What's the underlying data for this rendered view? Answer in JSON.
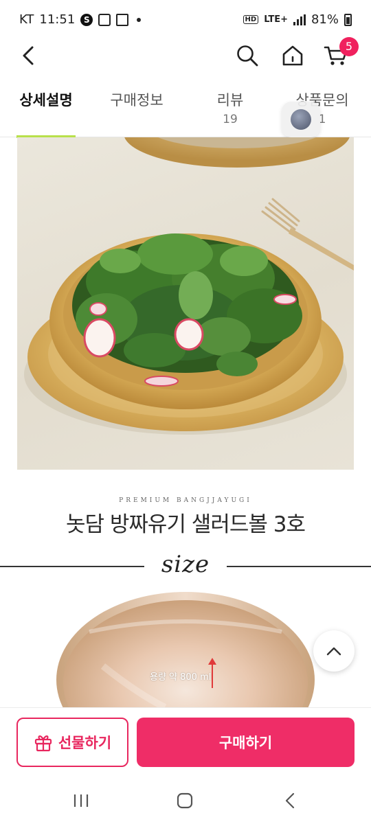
{
  "status_bar": {
    "carrier": "KT",
    "time": "11:51",
    "network": "LTE+",
    "hd": "HD",
    "battery": "81%"
  },
  "header": {
    "icons": [
      "back-icon",
      "search-icon",
      "home-icon",
      "cart-icon"
    ],
    "cart_count": "5"
  },
  "tabs": [
    {
      "label": "상세설명",
      "count": "",
      "active": true
    },
    {
      "label": "구매정보",
      "count": ""
    },
    {
      "label": "리뷰",
      "count": "19"
    },
    {
      "label": "상품문의",
      "count": "1"
    }
  ],
  "detail": {
    "brand_line": "PREMIUM BANGJJAYUGI",
    "title": "놋담 방짜유기 샐러드볼 3호",
    "size_label": "size",
    "capacity": "용량 약 800 ml"
  },
  "bottom_bar": {
    "gift_label": "선물하기",
    "buy_label": "구매하기"
  },
  "colors": {
    "accent": "#ef2d67",
    "tab_underline": "#b8e04a",
    "badge": "#f0215e"
  }
}
